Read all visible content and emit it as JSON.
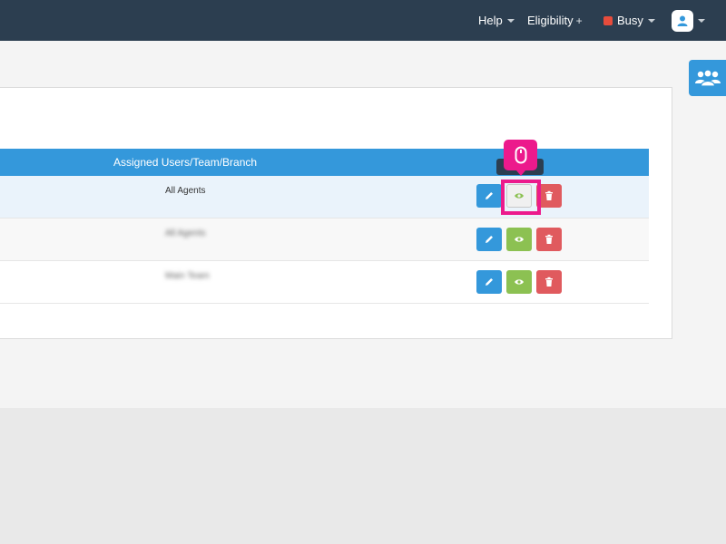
{
  "header": {
    "help_label": "Help",
    "eligibility_label": "Eligibility",
    "eligibility_plus": "+",
    "status_label": "Busy",
    "colors": {
      "bar": "#2c3e50",
      "status": "#e74c3c"
    }
  },
  "side_tab": {
    "icon": "users-icon"
  },
  "table": {
    "header_label": "Assigned Users/Team/Branch",
    "rows": [
      {
        "assigned": "All Agents"
      },
      {
        "assigned": "All Agents"
      },
      {
        "assigned": "Main Team"
      }
    ],
    "actions": {
      "edit_icon": "pencil-icon",
      "view_icon": "eye-icon",
      "delete_icon": "trash-icon"
    }
  },
  "overlay": {
    "highlight_color": "#ec1a8c",
    "cursor_icon": "mouse-icon"
  }
}
